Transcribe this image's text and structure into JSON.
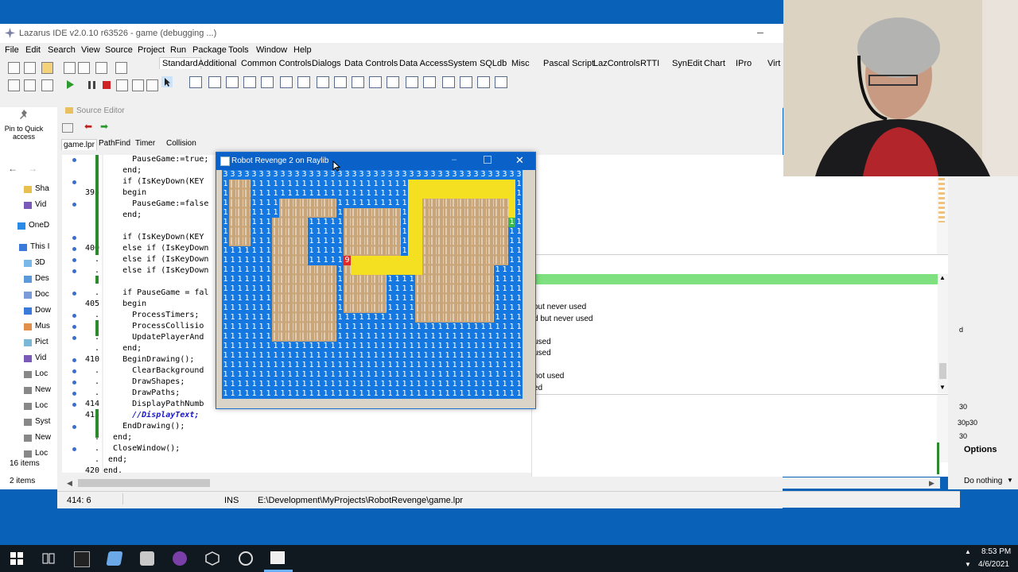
{
  "ide": {
    "title": "Lazarus IDE v2.0.10 r63526 - game (debugging ...)",
    "menu": [
      "File",
      "Edit",
      "Search",
      "View",
      "Source",
      "Project",
      "Run",
      "Package",
      "Tools",
      "Window",
      "Help"
    ],
    "palette_tabs": [
      "Standard",
      "Additional",
      "Common Controls",
      "Dialogs",
      "Data Controls",
      "Data Access",
      "System",
      "SQLdb",
      "Misc",
      "Pascal Script",
      "LazControls",
      "RTTI",
      "SynEdit",
      "Chart",
      "IPro",
      "Virt"
    ]
  },
  "explorer": {
    "pin_label": "Pin to Quick access",
    "items": [
      "Sha",
      "Vid",
      "OneD",
      "This I",
      "3D",
      "Des",
      "Doc",
      "Dow",
      "Mus",
      "Pict",
      "Vid",
      "Loc",
      "New",
      "Loc",
      "Syst",
      "New",
      "Loc"
    ],
    "count": "16 items",
    "footer": "2 items"
  },
  "editor": {
    "header": "Source Editor",
    "tabs": [
      "game.lpr",
      "PathFind",
      "Timer",
      "Collision"
    ],
    "lines": [
      {
        "n": "",
        "t": "      PauseGame:=true;"
      },
      {
        "n": "",
        "t": "    end;"
      },
      {
        "n": "",
        "t": "    if (IsKeyDown(KEY"
      },
      {
        "n": "395",
        "t": "    begin"
      },
      {
        "n": "",
        "t": "      PauseGame:=false"
      },
      {
        "n": "",
        "t": "    end;"
      },
      {
        "n": "",
        "t": ""
      },
      {
        "n": "",
        "t": "    if (IsKeyDown(KEY"
      },
      {
        "n": "400",
        "t": "    else if (IsKeyDown"
      },
      {
        "n": "",
        "t": "    else if (IsKeyDown"
      },
      {
        "n": "",
        "t": "    else if (IsKeyDown"
      },
      {
        "n": "",
        "t": ""
      },
      {
        "n": "",
        "t": "    if PauseGame = fal"
      },
      {
        "n": "405",
        "t": "    begin"
      },
      {
        "n": "",
        "t": "      ProcessTimers;"
      },
      {
        "n": "",
        "t": "      ProcessCollisio"
      },
      {
        "n": "",
        "t": "      UpdatePlayerAnd"
      },
      {
        "n": "",
        "t": "    end;"
      },
      {
        "n": "410",
        "t": "    BeginDrawing();"
      },
      {
        "n": "",
        "t": "      ClearBackground"
      },
      {
        "n": "",
        "t": "      DrawShapes;"
      },
      {
        "n": "",
        "t": "      DrawPaths;"
      },
      {
        "n": "414",
        "t": "      DisplayPathNumb"
      },
      {
        "n": "415",
        "t": "      //DisplayText;"
      },
      {
        "n": "",
        "t": "    EndDrawing();"
      },
      {
        "n": "",
        "t": "  end;"
      },
      {
        "n": "",
        "t": "  CloseWindow();"
      },
      {
        "n": "",
        "t": " end;"
      },
      {
        "n": "420",
        "t": "end."
      }
    ],
    "status": {
      "pos": "414: 6",
      "mode": "INS",
      "path": "E:\\Development\\MyProjects\\RobotRevenge\\game.lpr"
    }
  },
  "messages": {
    "lines": [
      "out never used",
      "d but never used",
      "",
      "used",
      "used",
      "",
      "not used",
      "ed"
    ]
  },
  "robot": {
    "title": "Robot Revenge 2 on Raylib",
    "marker": "9"
  },
  "right_panel": {
    "options_label": "Options",
    "do_nothing_label": "Do nothing",
    "snippets": [
      "d",
      "30",
      "30p30",
      "30"
    ]
  },
  "taskbar": {
    "time": "8:53 PM",
    "date": "4/6/2021"
  },
  "colors": {
    "desktop": "#0a62b8",
    "game_blue": "#1478e0",
    "game_tan": "#c8a67a",
    "game_yellow": "#f4e020",
    "game_red": "#e02828",
    "msg_bar": "#7ee07e"
  }
}
